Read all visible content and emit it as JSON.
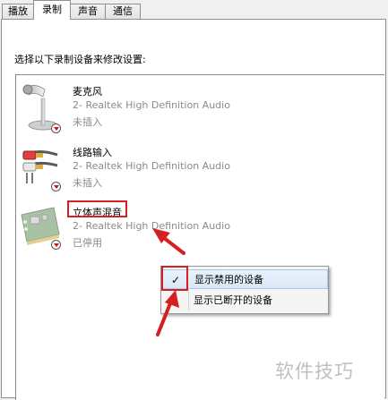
{
  "tabs": [
    {
      "label": "播放"
    },
    {
      "label": "录制",
      "active": true
    },
    {
      "label": "声音"
    },
    {
      "label": "通信"
    }
  ],
  "instruction": "选择以下录制设备来修改设置:",
  "devices": [
    {
      "name": "麦克风",
      "driver": "2- Realtek High Definition Audio",
      "status": "未插入",
      "icon": "microphone-icon"
    },
    {
      "name": "线路输入",
      "driver": "2- Realtek High Definition Audio",
      "status": "未插入",
      "icon": "line-in-cable-icon"
    },
    {
      "name": "立体声混音",
      "driver": "2- Realtek High Definition Audio",
      "status": "已停用",
      "icon": "sound-card-icon"
    }
  ],
  "context_menu": {
    "items": [
      {
        "label": "显示禁用的设备",
        "checked": true,
        "check_glyph": "✓"
      },
      {
        "label": "显示已断开的设备",
        "checked": false
      }
    ]
  },
  "watermark": "软件技巧",
  "colors": {
    "annotation_red": "#d42020",
    "disabled_text": "#8a8a8a",
    "menu_hover": "#d9e8f8"
  }
}
